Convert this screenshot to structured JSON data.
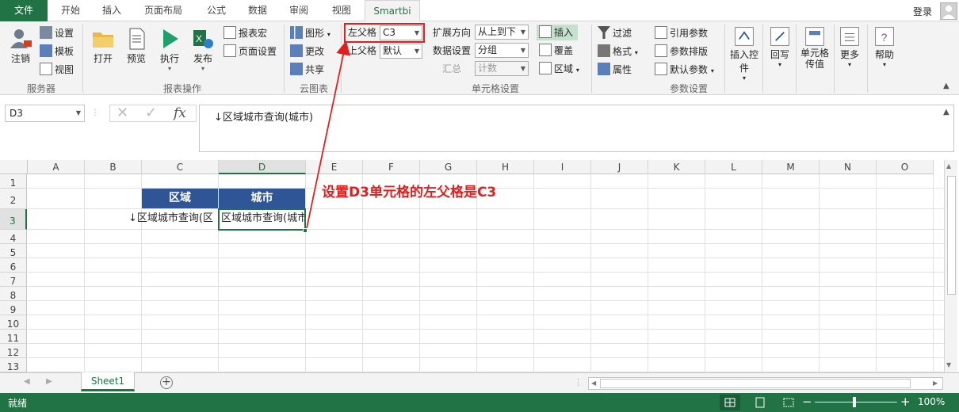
{
  "tabs": [
    "文件",
    "开始",
    "插入",
    "页面布局",
    "公式",
    "数据",
    "审阅",
    "视图",
    "Smartbi"
  ],
  "login": "登录",
  "ribbon": {
    "server": {
      "logout": "注销",
      "settings": "设置",
      "template": "模板",
      "view": "视图",
      "label": "服务器"
    },
    "report_ops": {
      "open": "打开",
      "preview": "预览",
      "execute": "执行",
      "publish": "发布",
      "report_macro": "报表宏",
      "page_settings": "页面设置",
      "label": "报表操作"
    },
    "cloud": {
      "chart": "图形",
      "update": "更改",
      "share": "共享",
      "label": "云图表"
    },
    "cell": {
      "left_parent_label": "左父格",
      "left_parent_value": "C3",
      "top_parent_label": "上父格",
      "top_parent_value": "默认",
      "expand_dir_label": "扩展方向",
      "expand_dir_value": "从上到下",
      "data_settings_label": "数据设置",
      "data_settings_value": "分组",
      "summary_label": "汇总",
      "summary_value": "计数",
      "insert": "插入",
      "cover": "覆盖",
      "region": "区域",
      "label": "单元格设置"
    },
    "params": {
      "filter": "过滤",
      "format": "格式",
      "attribute": "属性",
      "ref_param": "引用参数",
      "param_layout": "参数排版",
      "default_param": "默认参数",
      "label": "参数设置"
    },
    "misc": {
      "insert_control": "插入控件",
      "writeback": "回写",
      "cell_pass": "单元格传值",
      "more": "更多",
      "help": "帮助"
    }
  },
  "formula": {
    "namebox": "D3",
    "content": "↓区域城市查询(城市)"
  },
  "columns": [
    "A",
    "B",
    "C",
    "D",
    "E",
    "F",
    "G",
    "H",
    "I",
    "J",
    "K",
    "L",
    "M",
    "N",
    "O"
  ],
  "rows": [
    "1",
    "2",
    "3",
    "4",
    "5",
    "6",
    "7",
    "8",
    "9",
    "10",
    "11",
    "12",
    "13"
  ],
  "cells": {
    "c2": "区域",
    "d2": "城市",
    "c3": "↓区域城市查询(区",
    "d3": "区域城市查询(城市)"
  },
  "annotation": "设置D3单元格的左父格是C3",
  "sheet_tab": "Sheet1",
  "status": {
    "ready": "就绪",
    "zoom": "100%"
  },
  "colors": {
    "excel_green": "#217346",
    "header_blue": "#2f5597",
    "annotation_red": "#e02020"
  }
}
